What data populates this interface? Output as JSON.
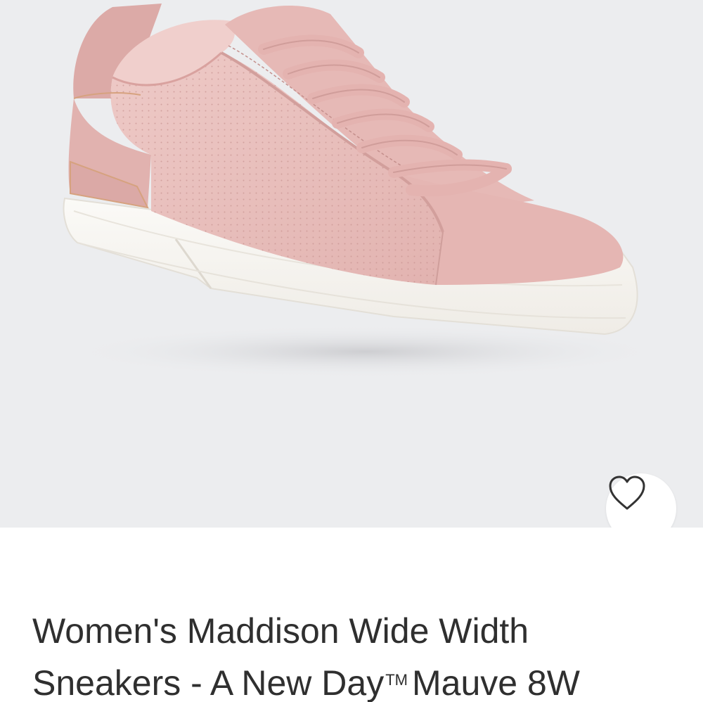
{
  "product": {
    "title_line1": "Women's Maddison Wide Width",
    "title_line2_before_tm": "Sneakers - A New Day",
    "trademark": "TM",
    "title_line2_after_tm": "Mauve 8W",
    "image": {
      "subject": "pink perforated low-top lace-up sneaker",
      "background_color": "#ecedef",
      "upper_color": "#e8bfbd",
      "sole_color": "#f8f6f2"
    }
  },
  "favorite": {
    "icon": "heart-outline-icon"
  }
}
